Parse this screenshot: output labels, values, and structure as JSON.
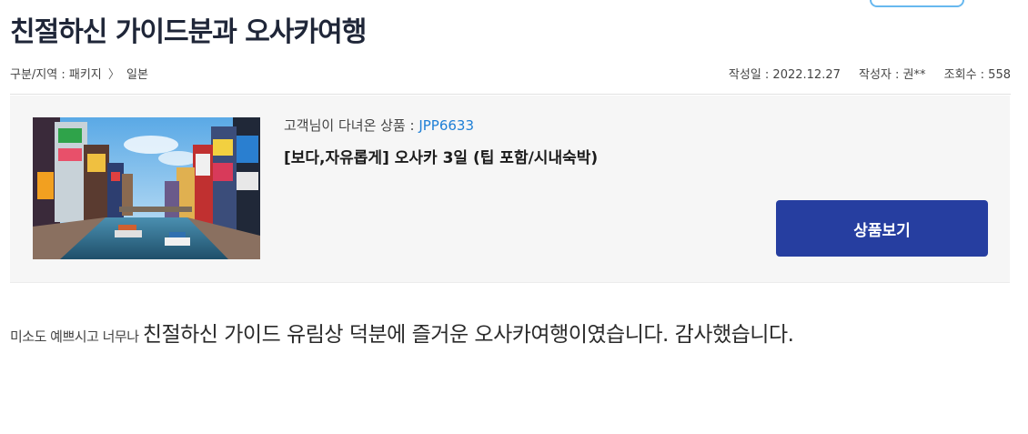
{
  "header": {
    "title": "친절하신 가이드분과 오사카여행"
  },
  "meta": {
    "breadcrumb": [
      "구분/지역 : 패키지",
      "일본"
    ],
    "breadcrumb_separator": "〉",
    "date": "작성일 : 2022.12.27",
    "author": "작성자 : 권**",
    "views": "조회수 : 558"
  },
  "product": {
    "visited_label": "고객님이 다녀온 상품 : ",
    "product_code": "JPP6633",
    "name": "[보다,자유롭게] 오사카 3일 (팁 포함/시내숙박)",
    "button_label": "상품보기",
    "image_icon": "osaka-dotonbori-photo"
  },
  "review": {
    "text_small": "미소도 예쁘시고 너무나 ",
    "text_large": "친절하신 가이드 유림상 덕분에 즐거운 오사카여행이였습니다. 감사했습니다."
  },
  "colors": {
    "accent_button": "#263ea0",
    "link": "#1e7fd6",
    "panel_bg": "#f6f6f6"
  }
}
